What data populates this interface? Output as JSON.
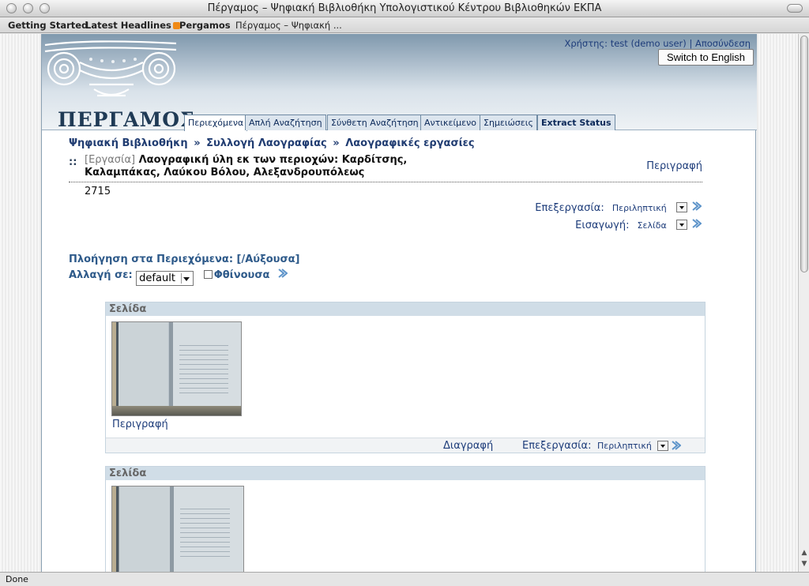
{
  "window": {
    "title": "Πέργαμος – Ψηφιακή Βιβλιοθήκη Υπολογιστικού Κέντρου Βιβλιοθηκών ΕΚΠΑ",
    "status": "Done"
  },
  "bookmarks": [
    "Getting Started",
    "Latest Headlines",
    "Pergamos",
    "Πέργαμος – Ψηφιακή ..."
  ],
  "header": {
    "logo_text": "ΠΕΡΓΑΜΟΣ",
    "user_label": "Χρήστης:",
    "user_name": "test (demo user)",
    "separator": "|",
    "logout": "Αποσύνδεση",
    "switch_language": "Switch to English"
  },
  "tabs": [
    {
      "label": "Περιεχόμενα",
      "active": true
    },
    {
      "label": "Απλή Αναζήτηση",
      "active": false
    },
    {
      "label": "Σύνθετη Αναζήτηση",
      "active": false
    },
    {
      "label": "Αντικείμενο",
      "active": false
    },
    {
      "label": "Σημειώσεις",
      "active": false
    },
    {
      "label": "Extract Status",
      "active": false
    }
  ],
  "breadcrumb": [
    "Ψηφιακή Βιβλιοθήκη",
    "Συλλογή Λαογραφίας",
    "Λαογραφικές εργασίες"
  ],
  "breadcrumb_sep": "»",
  "record": {
    "bullet": "::",
    "type": "[Εργασία]",
    "title": "Λαογραφική ύλη εκ των περιοχών: Καρδίτσης, Καλαμπάκας, Λαύκου Βόλου, Αλεξανδρουπόλεως",
    "description_link": "Περιγραφή",
    "number": "2715"
  },
  "controls": {
    "edit_label": "Επεξεργασία:",
    "edit_value": "Περιληπτική",
    "import_label": "Εισαγωγή:",
    "import_value": "Σελίδα"
  },
  "browse": {
    "label": "Πλοήγηση στα Περιεχόμενα: [/Αύξουσα]",
    "change_label": "Αλλαγή σε:",
    "select_value": "default",
    "descending_label": "Φθίνουσα",
    "descending_checked": false
  },
  "pages": [
    {
      "header": "Σελίδα",
      "description": "Περιγραφή",
      "delete": "Διαγραφή",
      "edit_label": "Επεξεργασία:",
      "edit_value": "Περιληπτική"
    },
    {
      "header": "Σελίδα"
    }
  ],
  "colors": {
    "link": "#1d3c7a",
    "header_band": "#d0dde7",
    "accent": "#2e5a8a"
  }
}
